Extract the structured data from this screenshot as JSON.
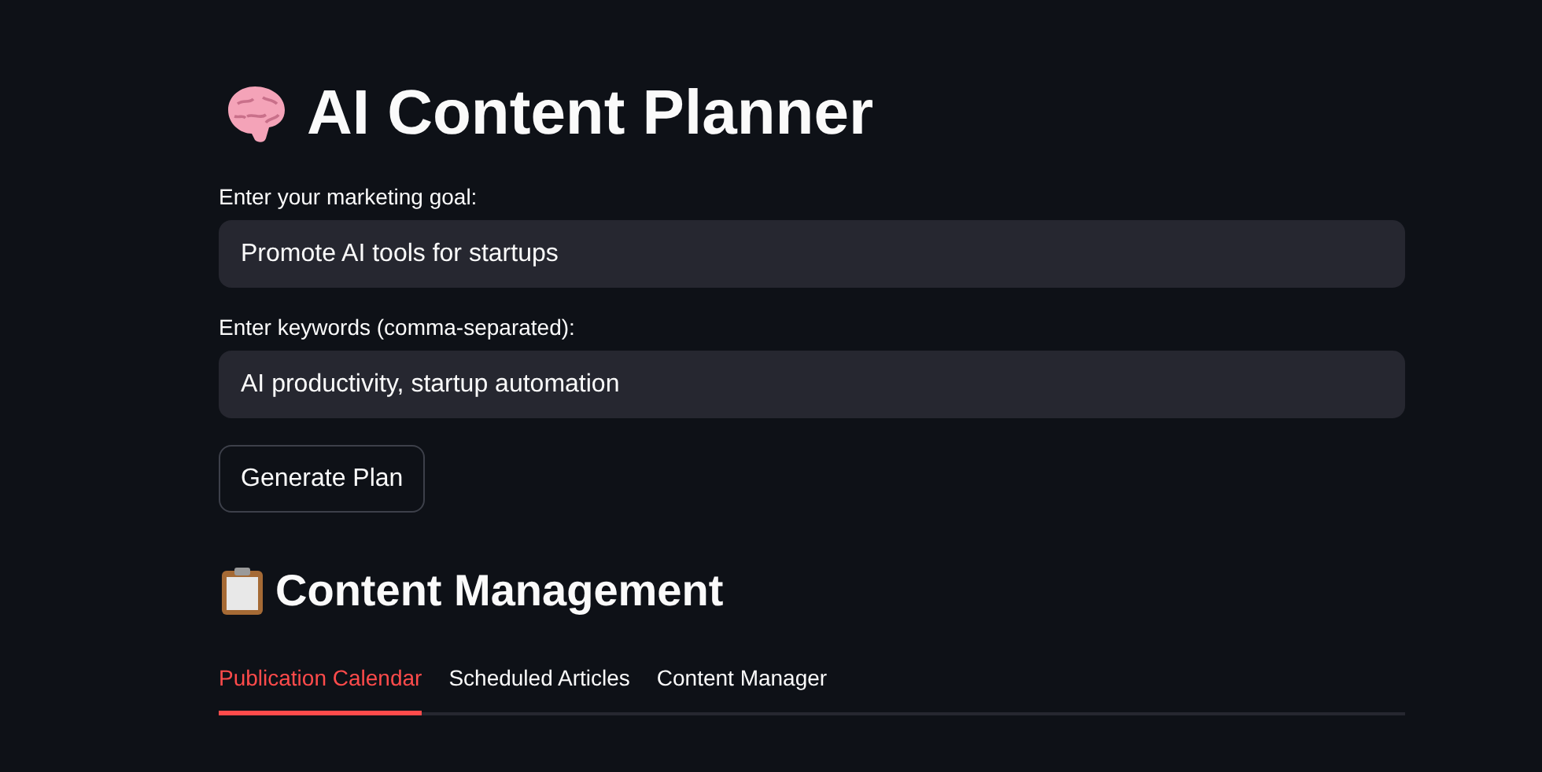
{
  "title": "AI Content Planner",
  "fields": [
    {
      "label": "Enter your marketing goal:",
      "value": "Promote AI tools for startups"
    },
    {
      "label": "Enter keywords (comma-separated):",
      "value": "AI productivity, startup automation"
    }
  ],
  "button": "Generate Plan",
  "section_title": "Content Management",
  "tabs": [
    {
      "label": "Publication Calendar",
      "selected": true
    },
    {
      "label": "Scheduled Articles",
      "selected": false
    },
    {
      "label": "Content Manager",
      "selected": false
    }
  ]
}
